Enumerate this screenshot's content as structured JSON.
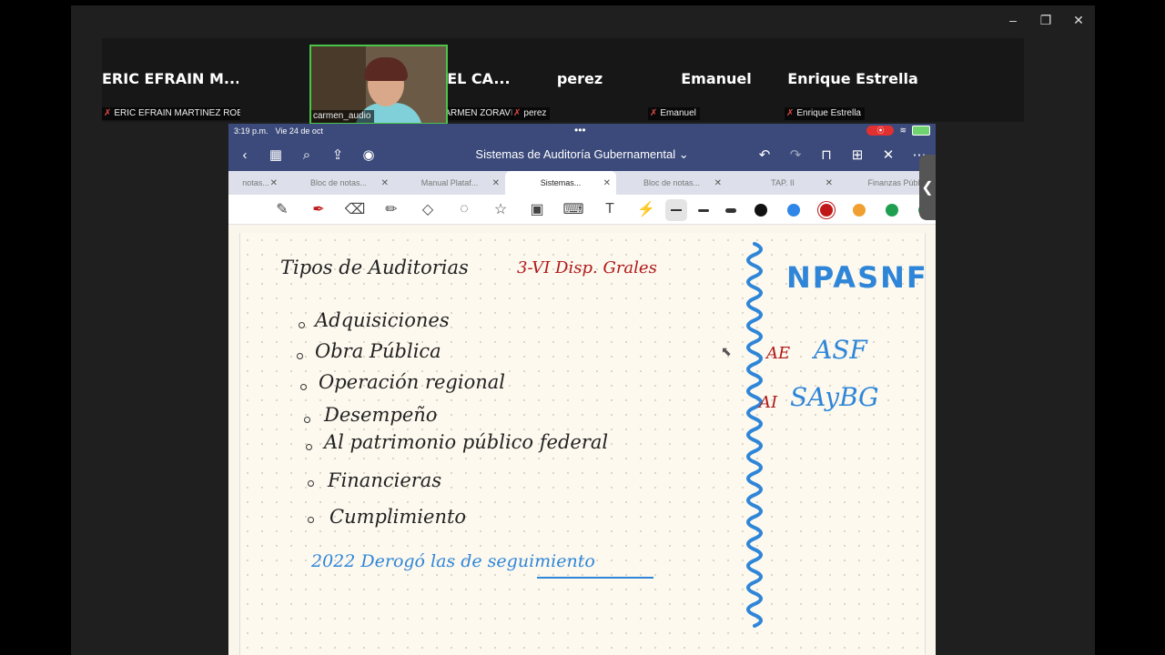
{
  "window": {
    "minimize": "–",
    "maximize": "❐",
    "close": "✕"
  },
  "participants": [
    {
      "name": "ERIC EFRAIN M...",
      "label": "ERIC EFRAIN MARTINEZ ROB..."
    },
    {
      "name": "",
      "label": "carmen_audio"
    },
    {
      "name": "MARIA DEL CA...",
      "label": "MARIA DEL CARMEN ZORAVILL..."
    },
    {
      "name": "perez",
      "label": "perez"
    },
    {
      "name": "Emanuel",
      "label": "Emanuel"
    },
    {
      "name": "Enrique Estrella",
      "label": "Enrique Estrella"
    }
  ],
  "status": {
    "time": "3:19 p.m.",
    "date": "Vie 24 de oct",
    "dots": "•••"
  },
  "nav": {
    "title": "Sistemas de Auditoría Gubernamental ⌄"
  },
  "tabs": [
    {
      "label": "notas..."
    },
    {
      "label": "Bloc de notas..."
    },
    {
      "label": "Manual Plataf..."
    },
    {
      "label": "Sistemas..."
    },
    {
      "label": "Bloc de notas..."
    },
    {
      "label": "TAP. II"
    },
    {
      "label": "Finanzas Públ"
    }
  ],
  "tab_close": "✕",
  "pen_colors": [
    "#111111",
    "#2e86e8",
    "#c01818",
    "#f0a030",
    "#1fa050",
    "#1fa050"
  ],
  "handle": "❮",
  "notes": {
    "title": "Tipos de Auditorias",
    "title_ref": "3-VI   Disp. Grales",
    "items": [
      "Adquisiciones",
      "Obra Pública",
      "Operación regional",
      "Desempeño",
      "Al patrimonio público federal",
      "Financieras",
      "Cumplimiento"
    ],
    "footer": "2022  Derogó  las  de  seguimiento",
    "side_title": "NPASNF",
    "ae_label": "AE",
    "ae_value": "ASF",
    "ai_label": "AI",
    "ai_value": "SAyBG"
  }
}
